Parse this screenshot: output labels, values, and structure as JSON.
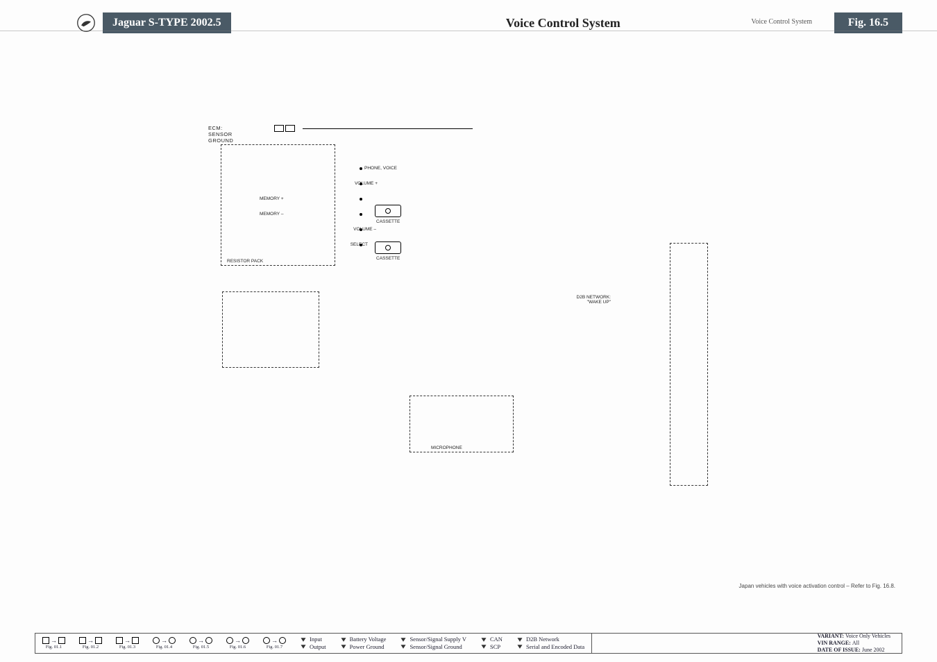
{
  "header": {
    "vehicle": "Jaguar S-TYPE 2002.5",
    "title": "Voice Control System",
    "right_small": "Voice Control System",
    "fig_label": "Fig. 16.5"
  },
  "diagram": {
    "ecm_label": "ECM: SENSOR GROUND",
    "resistor_pack": "RESISTOR PACK",
    "signals": {
      "phone_voice": "PHONE, VOICE",
      "volume_plus": "VOLUME +",
      "memory_plus": "MEMORY +",
      "memory_minus": "MEMORY –",
      "volume_minus": "VOLUME –",
      "select": "SELECT"
    },
    "cassette": "CASSETTE",
    "microphone": "MICROPHONE",
    "d2b": "D2B NETWORK: \"WAKE UP\""
  },
  "note": "Japan vehicles with voice activation control – Refer to Fig. 16.8.",
  "footer": {
    "figs": [
      "Fig. 01.1",
      "Fig. 01.2",
      "Fig. 01.3",
      "Fig. 01.4",
      "Fig. 01.5",
      "Fig. 01.6",
      "Fig. 01.7"
    ],
    "legend": {
      "input": "Input",
      "output": "Output",
      "batt": "Battery Voltage",
      "pground": "Power Ground",
      "ssv": "Sensor/Signal Supply V",
      "ssg": "Sensor/Signal Ground",
      "can": "CAN",
      "scp": "SCP",
      "d2b": "D2B Network",
      "serial": "Serial and Encoded Data"
    },
    "meta": {
      "variant_l": "VARIANT:",
      "variant_v": "Voice Only Vehicles",
      "vin_l": "VIN RANGE:",
      "vin_v": "All",
      "date_l": "DATE OF ISSUE:",
      "date_v": "June 2002"
    }
  }
}
